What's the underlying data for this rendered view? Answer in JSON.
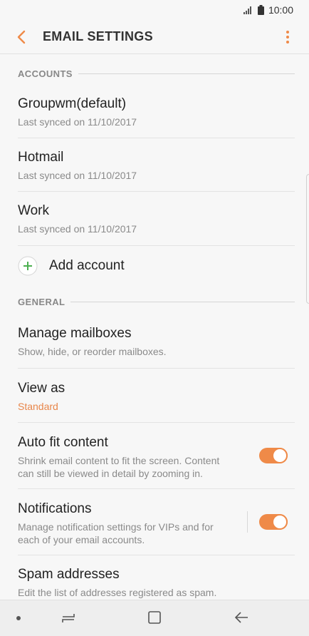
{
  "status": {
    "time": "10:00"
  },
  "header": {
    "title": "EMAIL SETTINGS"
  },
  "sections": {
    "accounts_label": "ACCOUNTS",
    "general_label": "GENERAL"
  },
  "accounts": [
    {
      "name": "Groupwm(default)",
      "sync": "Last synced on 11/10/2017"
    },
    {
      "name": "Hotmail",
      "sync": "Last synced on 11/10/2017"
    },
    {
      "name": "Work",
      "sync": "Last synced on 11/10/2017"
    }
  ],
  "add_account": {
    "label": "Add account"
  },
  "general": {
    "manage": {
      "title": "Manage mailboxes",
      "sub": "Show, hide, or reorder mailboxes."
    },
    "view_as": {
      "title": "View as",
      "value": "Standard"
    },
    "auto_fit": {
      "title": "Auto fit content",
      "sub_line1": "Shrink email content to fit the screen. Content",
      "sub_line2": "can still be viewed in detail by zooming in.",
      "enabled": true
    },
    "notifications": {
      "title": "Notifications",
      "sub_line1": "Manage notification settings for VIPs and for",
      "sub_line2": "each of your email accounts.",
      "enabled": true
    },
    "spam": {
      "title": "Spam addresses",
      "sub": "Edit the list of addresses registered as spam."
    }
  },
  "colors": {
    "accent": "#ef8a48",
    "add_green": "#4caf50"
  },
  "icons": [
    "signal-icon",
    "battery-icon",
    "back-arrow-icon",
    "more-vert-icon",
    "add-circle-icon",
    "nav-dot-icon",
    "recents-icon",
    "home-icon",
    "nav-back-icon"
  ]
}
